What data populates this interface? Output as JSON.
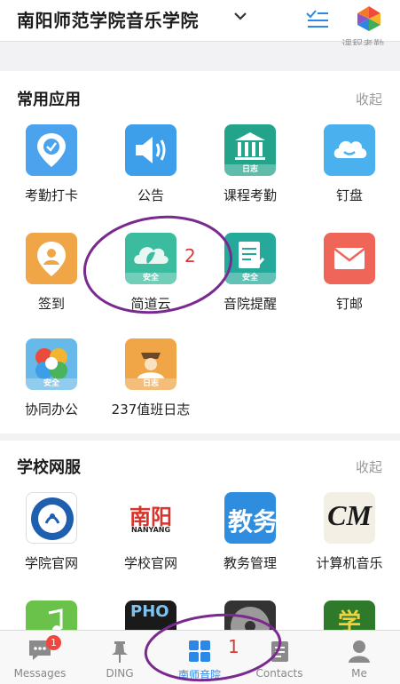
{
  "header": {
    "title": "南阳师范学院音乐学院",
    "cut_text": "课程考勤"
  },
  "common_apps": {
    "title": "常用应用",
    "action": "收起",
    "apps": [
      {
        "label": "考勤打卡",
        "icon": "attendance-checkin-icon",
        "color": "#4aa3ec"
      },
      {
        "label": "公告",
        "icon": "announcement-icon",
        "color": "#3d9fea"
      },
      {
        "label": "课程考勤",
        "icon": "course-attendance-icon",
        "color": "#22a38a",
        "badge": "日志"
      },
      {
        "label": "钉盘",
        "icon": "cloud-drive-icon",
        "color": "#4ab1ee"
      },
      {
        "label": "签到",
        "icon": "signin-icon",
        "color": "#f0a547"
      },
      {
        "label": "简道云",
        "icon": "jiandaoyun-icon",
        "color": "#3cbc9e",
        "badge": "安全"
      },
      {
        "label": "音院提醒",
        "icon": "reminder-icon",
        "color": "#25a99b",
        "badge": "安全"
      },
      {
        "label": "钉邮",
        "icon": "mail-icon",
        "color": "#ef6658"
      },
      {
        "label": "协同办公",
        "icon": "collab-office-icon",
        "color": "#66b9e8",
        "badge": "安全"
      },
      {
        "label": "237值班日志",
        "icon": "duty-log-icon",
        "color": "#f0a547",
        "badge": "日志"
      }
    ],
    "annotation": "2"
  },
  "school_services": {
    "title": "学校网服",
    "action": "收起",
    "apps": [
      {
        "label": "学院官网",
        "icon": "college-site-icon"
      },
      {
        "label": "学校官网",
        "icon": "school-site-icon",
        "logo_text": "南阳",
        "logo_sub": "NANYANG"
      },
      {
        "label": "教务管理",
        "icon": "academic-affairs-icon",
        "logo_text": "教务"
      },
      {
        "label": "计算机音乐",
        "icon": "computer-music-icon",
        "logo_text": "CM"
      }
    ],
    "partial_icons": [
      "music-note-icon",
      "pho-icon",
      "disc-icon",
      "xue-icon"
    ],
    "partial_texts": {
      "pho": "PHO",
      "xue": "学"
    }
  },
  "tabbar": {
    "tabs": [
      {
        "label": "Messages",
        "badge": "1"
      },
      {
        "label": "DING"
      },
      {
        "label": "南师音院"
      },
      {
        "label": "Contacts"
      },
      {
        "label": "Me"
      }
    ],
    "annotation": "1"
  },
  "colors": {
    "accent": "#2b88e6",
    "annotation_circle": "#7a2a8e",
    "annotation_number": "#d83a3a"
  }
}
